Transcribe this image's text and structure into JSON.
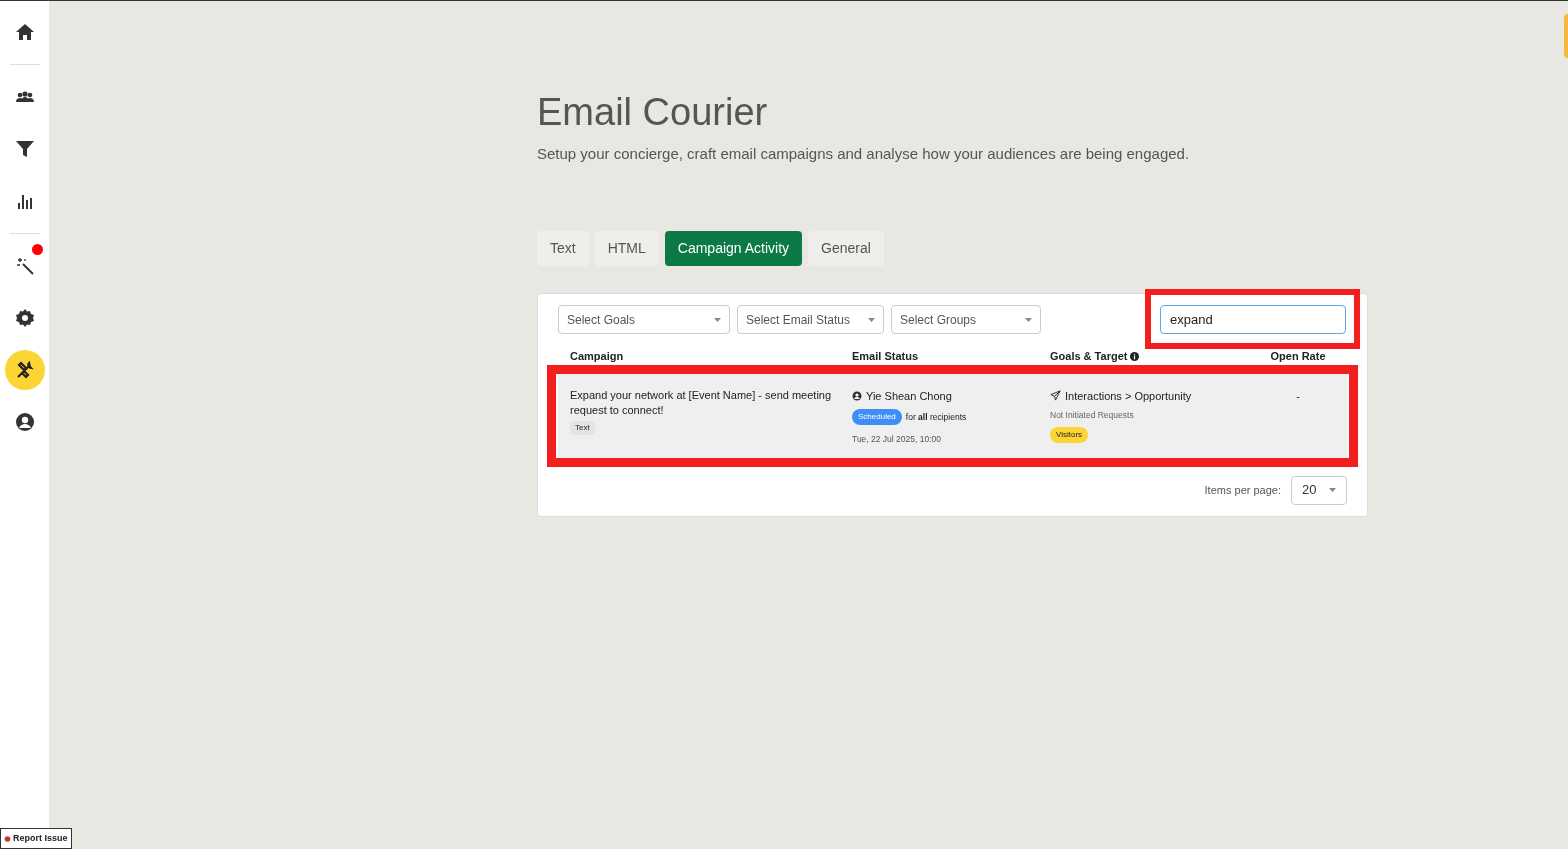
{
  "sidebar": {
    "items": [
      {
        "selected": false,
        "notification": false
      },
      {
        "selected": false,
        "notification": false
      },
      {
        "selected": false,
        "notification": false
      },
      {
        "selected": false,
        "notification": false
      },
      {
        "selected": false,
        "notification": true
      },
      {
        "selected": false,
        "notification": false
      },
      {
        "selected": true,
        "notification": false
      },
      {
        "selected": false,
        "notification": false
      }
    ]
  },
  "header": {
    "title": "Email Courier",
    "subtitle": "Setup your concierge, craft email campaigns and analyse how your audiences are being engaged."
  },
  "tabs": [
    {
      "label": "Text",
      "selected": false
    },
    {
      "label": "HTML",
      "selected": false
    },
    {
      "label": "Campaign Activity",
      "selected": true
    },
    {
      "label": "General",
      "selected": false
    }
  ],
  "filters": [
    {
      "placeholder": "Select Goals"
    },
    {
      "placeholder": "Select Email Status"
    },
    {
      "placeholder": "Select Groups"
    }
  ],
  "search": {
    "value": "expand",
    "highlighted": true
  },
  "table": {
    "columns": [
      "Campaign",
      "Email Status",
      "Goals & Target",
      "Open Rate"
    ],
    "rows": [
      {
        "highlighted": true,
        "campaign": "Expand your network at [Event Name] - send meeting request to connect!",
        "type_tag": "Text",
        "sender": "Yie Shean Chong",
        "status": "Scheduled",
        "recipients": "for **all** recipients",
        "date": "Tue, 22 Jul 2025, 10:00",
        "goal": "Interactions > Opportunity",
        "target": "Not Initiated Requests",
        "group_tag": "Visitors",
        "open_rate": "-"
      }
    ]
  },
  "pagination": {
    "label": "Items per page:",
    "value": "20"
  },
  "report_issue": {
    "label": "Report Issue"
  }
}
